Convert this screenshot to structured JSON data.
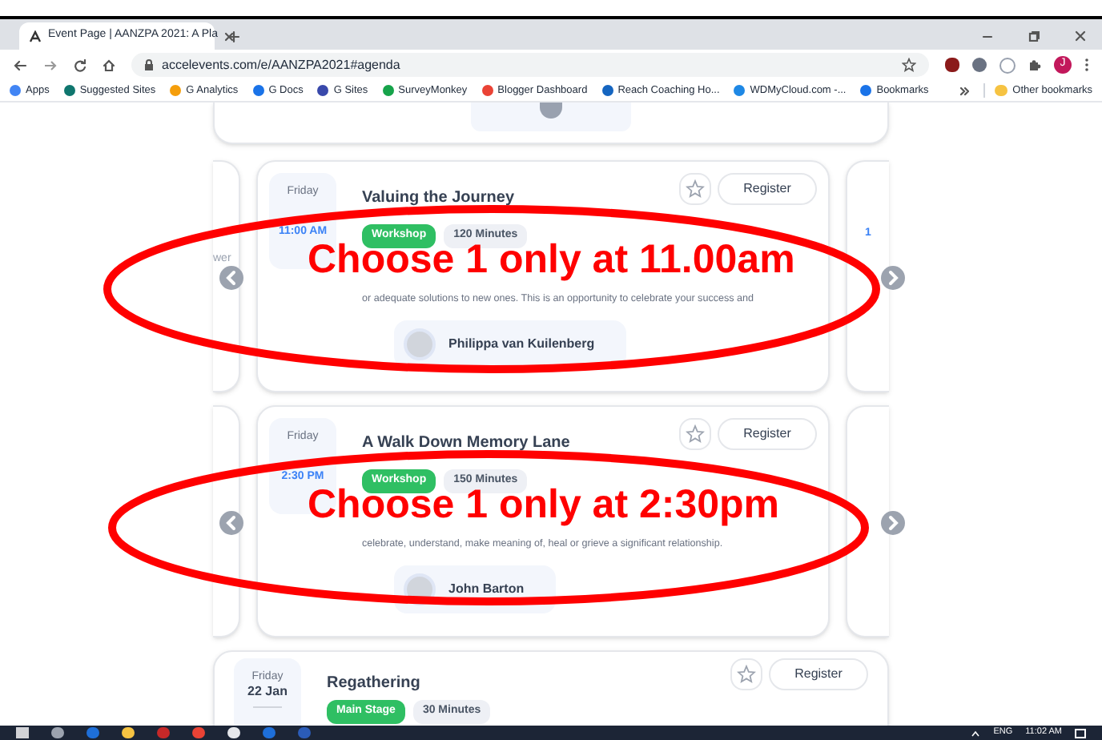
{
  "browser": {
    "tab_title": "Event Page | AANZPA 2021: A Pla",
    "url": "accelevents.com/e/AANZPA2021#agenda",
    "bookmarks": [
      "Apps",
      "Suggested Sites",
      "G Analytics",
      "G Docs",
      "G Sites",
      "SurveyMonkey",
      "Blogger Dashboard",
      "Reach Coaching Ho...",
      "WDMyCloud.com -...",
      "Bookmarks"
    ],
    "other_bookmarks": "Other bookmarks",
    "profile": "J"
  },
  "sessions": [
    {
      "day": "Friday",
      "time": "11:00 AM",
      "title": "Valuing the Journey",
      "tags": [
        {
          "label": "Workshop",
          "kind": "category"
        },
        {
          "label": "120 Minutes",
          "kind": "duration"
        }
      ],
      "description": "or adequate solutions to new ones. This is an opportunity to celebrate your success and",
      "speaker": "Philippa van Kuilenberg",
      "prev_peek": "wer",
      "next_peek": "1",
      "action": "Register",
      "starred": false
    },
    {
      "day": "Friday",
      "time": "2:30 PM",
      "title": "A Walk Down Memory Lane",
      "tags": [
        {
          "label": "Workshop",
          "kind": "category"
        },
        {
          "label": "150 Minutes",
          "kind": "duration"
        }
      ],
      "description": "celebrate, understand, make meaning of, heal or grieve a significant relationship.",
      "speaker": "John Barton",
      "action": "Register",
      "starred": false
    },
    {
      "day": "Friday",
      "date": "22 Jan",
      "title": "Regathering",
      "tags": [
        {
          "label": "Main Stage",
          "kind": "category"
        },
        {
          "label": "30 Minutes",
          "kind": "duration"
        }
      ],
      "action": "Register",
      "starred": false
    }
  ],
  "annotations": [
    {
      "text": "Choose 1 only at 11.00am"
    },
    {
      "text": "Choose 1 only at 2:30pm"
    }
  ],
  "taskbar": {
    "language": "ENG",
    "clock": "11:02 AM"
  }
}
